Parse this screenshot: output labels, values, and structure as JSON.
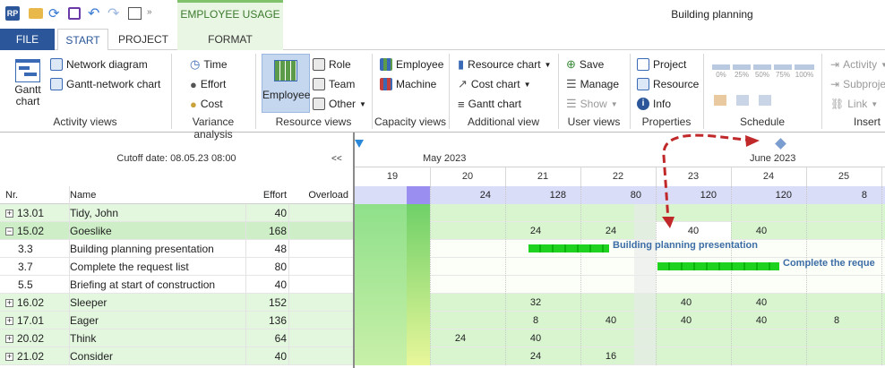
{
  "window": {
    "title": "Building planning",
    "context_tab": "EMPLOYEE USAGE"
  },
  "tabs": [
    {
      "label": "FILE"
    },
    {
      "label": "START"
    },
    {
      "label": "PROJECT"
    },
    {
      "label": "FORMAT"
    }
  ],
  "groups": {
    "activity_views": {
      "label": "Activity views",
      "gantt": "Gantt chart",
      "network": "Network diagram",
      "gantt_network": "Gantt-network chart"
    },
    "variance": {
      "label": "Variance analysis",
      "time": "Time",
      "effort": "Effort",
      "cost": "Cost"
    },
    "resource_views": {
      "label": "Resource views",
      "employee": "Employee",
      "role": "Role",
      "team": "Team",
      "other": "Other"
    },
    "capacity_views": {
      "label": "Capacity views",
      "employee": "Employee",
      "machine": "Machine"
    },
    "additional": {
      "label": "Additional view",
      "resource_chart": "Resource chart",
      "cost_chart": "Cost chart",
      "gantt_chart": "Gantt chart"
    },
    "user_views": {
      "label": "User views",
      "save": "Save",
      "manage": "Manage",
      "show": "Show"
    },
    "properties": {
      "label": "Properties",
      "project": "Project",
      "resource": "Resource",
      "info": "Info"
    },
    "schedule": {
      "label": "Schedule",
      "pcts": [
        "0%",
        "25%",
        "50%",
        "75%",
        "100%"
      ]
    },
    "insert": {
      "label": "Insert",
      "activity": "Activity",
      "subproject": "Subproje",
      "link": "Link"
    }
  },
  "left": {
    "cutoff": "Cutoff date: 08.05.23 08:00",
    "collapse": "<<",
    "headers": {
      "nr": "Nr.",
      "name": "Name",
      "effort": "Effort",
      "overload": "Overload"
    },
    "rows": [
      {
        "nr": "13.01",
        "name": "Tidy, John",
        "effort": "40",
        "toggle": "+"
      },
      {
        "nr": "15.02",
        "name": "Goeslike",
        "effort": "168",
        "toggle": "−"
      },
      {
        "nr": "3.3",
        "name": "Building planning presentation",
        "effort": "48",
        "toggle": ""
      },
      {
        "nr": "3.7",
        "name": "Complete the request list",
        "effort": "80",
        "toggle": ""
      },
      {
        "nr": "5.5",
        "name": "Briefing at start of construction",
        "effort": "40",
        "toggle": ""
      },
      {
        "nr": "16.02",
        "name": "Sleeper",
        "effort": "152",
        "toggle": "+"
      },
      {
        "nr": "17.01",
        "name": "Eager",
        "effort": "136",
        "toggle": "+"
      },
      {
        "nr": "20.02",
        "name": "Think",
        "effort": "64",
        "toggle": "+"
      },
      {
        "nr": "21.02",
        "name": "Consider",
        "effort": "40",
        "toggle": "+"
      }
    ]
  },
  "gantt": {
    "months": [
      {
        "label": "May 2023"
      },
      {
        "label": "June 2023"
      }
    ],
    "days": [
      "19",
      "20",
      "21",
      "22",
      "23",
      "24",
      "25"
    ],
    "totals": [
      "",
      "24",
      "128",
      "80",
      "120",
      "120",
      "8"
    ],
    "rows": [
      [
        "",
        "",
        "",
        "",
        "",
        "",
        ""
      ],
      [
        "",
        "",
        "24",
        "24",
        "40",
        "40",
        ""
      ],
      [
        "",
        "",
        "",
        "",
        "",
        "",
        ""
      ],
      [
        "",
        "",
        "",
        "",
        "",
        "",
        ""
      ],
      [
        "",
        "",
        "",
        "",
        "",
        "",
        ""
      ],
      [
        "",
        "",
        "32",
        "",
        "40",
        "40",
        ""
      ],
      [
        "",
        "",
        "8",
        "40",
        "40",
        "40",
        "8"
      ],
      [
        "",
        "24",
        "40",
        "",
        "",
        "",
        ""
      ],
      [
        "",
        "",
        "24",
        "16",
        "",
        "",
        ""
      ]
    ],
    "bars": [
      {
        "label": "Building planning presentation"
      },
      {
        "label": "Complete the reque"
      }
    ]
  }
}
